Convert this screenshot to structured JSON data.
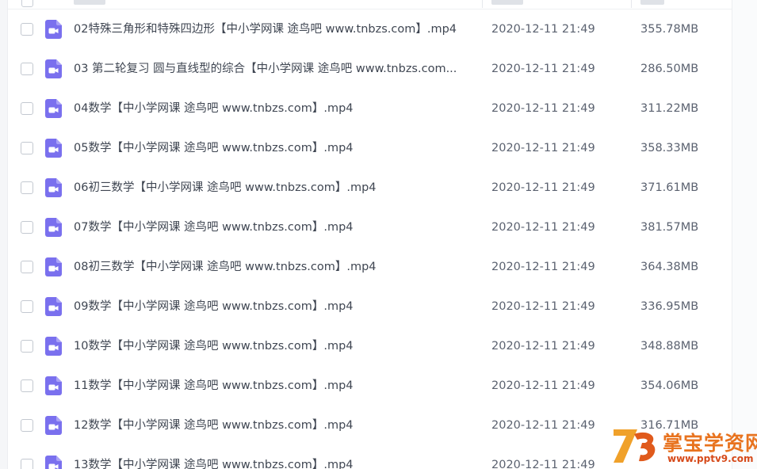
{
  "files": [
    {
      "name": "02特殊三角形和特殊四边形【中小学网课 途鸟吧 www.tnbzs.com】.mp4",
      "date": "2020-12-11 21:49",
      "size": "355.78MB"
    },
    {
      "name": "03 第二轮复习 圆与直线型的综合【中小学网课 途鸟吧 www.tnbzs.com...",
      "date": "2020-12-11 21:49",
      "size": "286.50MB"
    },
    {
      "name": "04数学【中小学网课 途鸟吧 www.tnbzs.com】.mp4",
      "date": "2020-12-11 21:49",
      "size": "311.22MB"
    },
    {
      "name": "05数学【中小学网课 途鸟吧 www.tnbzs.com】.mp4",
      "date": "2020-12-11 21:49",
      "size": "358.33MB"
    },
    {
      "name": "06初三数学【中小学网课 途鸟吧 www.tnbzs.com】.mp4",
      "date": "2020-12-11 21:49",
      "size": "371.61MB"
    },
    {
      "name": "07数学【中小学网课 途鸟吧 www.tnbzs.com】.mp4",
      "date": "2020-12-11 21:49",
      "size": "381.57MB"
    },
    {
      "name": "08初三数学【中小学网课 途鸟吧 www.tnbzs.com】.mp4",
      "date": "2020-12-11 21:49",
      "size": "364.38MB"
    },
    {
      "name": "09数学【中小学网课 途鸟吧 www.tnbzs.com】.mp4",
      "date": "2020-12-11 21:49",
      "size": "336.95MB"
    },
    {
      "name": "10数学【中小学网课 途鸟吧 www.tnbzs.com】.mp4",
      "date": "2020-12-11 21:49",
      "size": "348.88MB"
    },
    {
      "name": "11数学【中小学网课 途鸟吧 www.tnbzs.com】.mp4",
      "date": "2020-12-11 21:49",
      "size": "354.06MB"
    },
    {
      "name": "12数学【中小学网课 途鸟吧 www.tnbzs.com】.mp4",
      "date": "2020-12-11 21:49",
      "size": "316.71MB"
    },
    {
      "name": "13数学【中小学网课 途鸟吧 www.tnbzs.com】.mp4",
      "date": "2020-12-11 21:49",
      "size": ""
    }
  ],
  "watermark": {
    "title": "掌宝学资网",
    "url": "www.pptv9.com"
  },
  "icons": {
    "file_type": "video-file-icon",
    "file_icon_color": "#7a70ee",
    "row_checkbox": "checkbox-icon"
  }
}
